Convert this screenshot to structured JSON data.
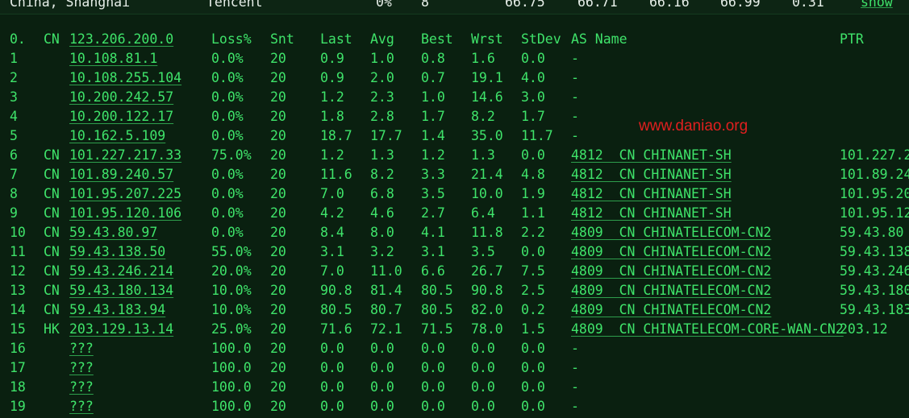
{
  "top_row": {
    "location": "China, Shanghai",
    "provider": "Tencent",
    "loss": "0%",
    "sent": "8",
    "v1": "66.75",
    "v2": "66.71",
    "v3": "66.16",
    "v4": "66.99",
    "v5": "0.31",
    "show_label": "show"
  },
  "header": {
    "hop": "0.",
    "cc": "CN",
    "host": "123.206.200.0",
    "loss": "Loss%",
    "snt": "Snt",
    "last": "Last",
    "avg": "Avg",
    "best": "Best",
    "wrst": "Wrst",
    "stdev": "StDev",
    "as_name": "AS Name",
    "ptr": "PTR"
  },
  "watermark": "www.daniao.org",
  "rows": [
    {
      "hop": "1",
      "cc": "",
      "host": "10.108.81.1",
      "loss": "0.0%",
      "snt": "20",
      "last": "0.9",
      "avg": "1.0",
      "best": "0.8",
      "wrst": "1.6",
      "stdev": "0.0",
      "as": "-",
      "ptr": ""
    },
    {
      "hop": "2",
      "cc": "",
      "host": "10.108.255.104",
      "loss": "0.0%",
      "snt": "20",
      "last": "0.9",
      "avg": "2.0",
      "best": "0.7",
      "wrst": "19.1",
      "stdev": "4.0",
      "as": "-",
      "ptr": ""
    },
    {
      "hop": "3",
      "cc": "",
      "host": "10.200.242.57",
      "loss": "0.0%",
      "snt": "20",
      "last": "1.2",
      "avg": "2.3",
      "best": "1.0",
      "wrst": "14.6",
      "stdev": "3.0",
      "as": "-",
      "ptr": ""
    },
    {
      "hop": "4",
      "cc": "",
      "host": "10.200.122.17",
      "loss": "0.0%",
      "snt": "20",
      "last": "1.8",
      "avg": "2.8",
      "best": "1.7",
      "wrst": "8.2",
      "stdev": "1.7",
      "as": "-",
      "ptr": ""
    },
    {
      "hop": "5",
      "cc": "",
      "host": "10.162.5.109",
      "loss": "0.0%",
      "snt": "20",
      "last": "18.7",
      "avg": "17.7",
      "best": "1.4",
      "wrst": "35.0",
      "stdev": "11.7",
      "as": "-",
      "ptr": ""
    },
    {
      "hop": "6",
      "cc": "CN",
      "host": "101.227.217.33",
      "loss": "75.0%",
      "snt": "20",
      "last": "1.2",
      "avg": "1.3",
      "best": "1.2",
      "wrst": "1.3",
      "stdev": "0.0",
      "as": "4812  CN CHINANET-SH",
      "ptr": "101.227.2"
    },
    {
      "hop": "7",
      "cc": "CN",
      "host": "101.89.240.57",
      "loss": "0.0%",
      "snt": "20",
      "last": "11.6",
      "avg": "8.2",
      "best": "3.3",
      "wrst": "21.4",
      "stdev": "4.8",
      "as": "4812  CN CHINANET-SH",
      "ptr": "101.89.24"
    },
    {
      "hop": "8",
      "cc": "CN",
      "host": "101.95.207.225",
      "loss": "0.0%",
      "snt": "20",
      "last": "7.0",
      "avg": "6.8",
      "best": "3.5",
      "wrst": "10.0",
      "stdev": "1.9",
      "as": "4812  CN CHINANET-SH",
      "ptr": "101.95.20"
    },
    {
      "hop": "9",
      "cc": "CN",
      "host": "101.95.120.106",
      "loss": "0.0%",
      "snt": "20",
      "last": "4.2",
      "avg": "4.6",
      "best": "2.7",
      "wrst": "6.4",
      "stdev": "1.1",
      "as": "4812  CN CHINANET-SH",
      "ptr": "101.95.12"
    },
    {
      "hop": "10",
      "cc": "CN",
      "host": "59.43.80.97",
      "loss": "0.0%",
      "snt": "20",
      "last": "8.4",
      "avg": "8.0",
      "best": "4.1",
      "wrst": "11.8",
      "stdev": "2.2",
      "as": "4809  CN CHINATELECOM-CN2",
      "ptr": "59.43.80"
    },
    {
      "hop": "11",
      "cc": "CN",
      "host": "59.43.138.50",
      "loss": "55.0%",
      "snt": "20",
      "last": "3.1",
      "avg": "3.2",
      "best": "3.1",
      "wrst": "3.5",
      "stdev": "0.0",
      "as": "4809  CN CHINATELECOM-CN2",
      "ptr": "59.43.138"
    },
    {
      "hop": "12",
      "cc": "CN",
      "host": "59.43.246.214",
      "loss": "20.0%",
      "snt": "20",
      "last": "7.0",
      "avg": "11.0",
      "best": "6.6",
      "wrst": "26.7",
      "stdev": "7.5",
      "as": "4809  CN CHINATELECOM-CN2",
      "ptr": "59.43.246"
    },
    {
      "hop": "13",
      "cc": "CN",
      "host": "59.43.180.134",
      "loss": "10.0%",
      "snt": "20",
      "last": "90.8",
      "avg": "81.4",
      "best": "80.5",
      "wrst": "90.8",
      "stdev": "2.5",
      "as": "4809  CN CHINATELECOM-CN2",
      "ptr": "59.43.180"
    },
    {
      "hop": "14",
      "cc": "CN",
      "host": "59.43.183.94",
      "loss": "10.0%",
      "snt": "20",
      "last": "80.5",
      "avg": "80.7",
      "best": "80.5",
      "wrst": "82.0",
      "stdev": "0.2",
      "as": "4809  CN CHINATELECOM-CN2",
      "ptr": "59.43.183"
    },
    {
      "hop": "15",
      "cc": "HK",
      "host": "203.129.13.14",
      "loss": "25.0%",
      "snt": "20",
      "last": "71.6",
      "avg": "72.1",
      "best": "71.5",
      "wrst": "78.0",
      "stdev": "1.5",
      "as": "4809  CN CHINATELECOM-CORE-WAN-CN2",
      "ptr": "203.12"
    },
    {
      "hop": "16",
      "cc": "",
      "host": "???",
      "loss": "100.0",
      "snt": "20",
      "last": "0.0",
      "avg": "0.0",
      "best": "0.0",
      "wrst": "0.0",
      "stdev": "0.0",
      "as": "-",
      "ptr": ""
    },
    {
      "hop": "17",
      "cc": "",
      "host": "???",
      "loss": "100.0",
      "snt": "20",
      "last": "0.0",
      "avg": "0.0",
      "best": "0.0",
      "wrst": "0.0",
      "stdev": "0.0",
      "as": "-",
      "ptr": ""
    },
    {
      "hop": "18",
      "cc": "",
      "host": "???",
      "loss": "100.0",
      "snt": "20",
      "last": "0.0",
      "avg": "0.0",
      "best": "0.0",
      "wrst": "0.0",
      "stdev": "0.0",
      "as": "-",
      "ptr": ""
    },
    {
      "hop": "19",
      "cc": "",
      "host": "???",
      "loss": "100.0",
      "snt": "20",
      "last": "0.0",
      "avg": "0.0",
      "best": "0.0",
      "wrst": "0.0",
      "stdev": "0.0",
      "as": "-",
      "ptr": ""
    }
  ]
}
